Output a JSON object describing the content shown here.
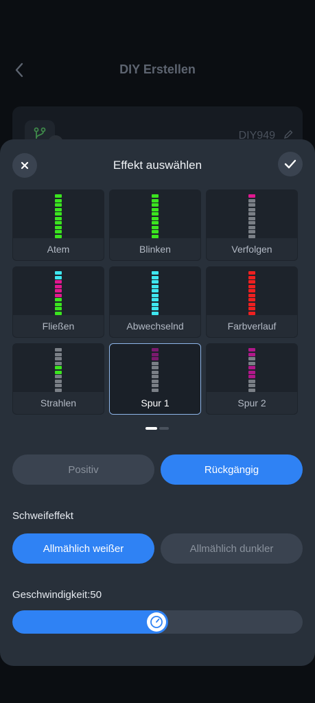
{
  "background": {
    "title": "DIY Erstellen",
    "device_name": "DIY949",
    "icons": {
      "back": "chevron-left-icon",
      "edit": "pencil-icon",
      "device": "branch-icon"
    }
  },
  "sheet": {
    "title": "Effekt auswählen",
    "icons": {
      "close": "close-icon",
      "confirm": "check-icon"
    }
  },
  "effects": [
    {
      "label": "Atem",
      "selected": false,
      "leds": [
        "#3be41f",
        "#3be41f",
        "#3be41f",
        "#3be41f",
        "#3be41f",
        "#3be41f",
        "#3be41f",
        "#3be41f",
        "#3be41f",
        "#3be41f"
      ]
    },
    {
      "label": "Blinken",
      "selected": false,
      "leds": [
        "#3be41f",
        "#3be41f",
        "#3be41f",
        "#3be41f",
        "#3be41f",
        "#3be41f",
        "#3be41f",
        "#3be41f",
        "#3be41f",
        "#3be41f"
      ]
    },
    {
      "label": "Verfolgen",
      "selected": false,
      "leds": [
        "#e0188f",
        "#7a7f86",
        "#7a7f86",
        "#7a7f86",
        "#7a7f86",
        "#7a7f86",
        "#7a7f86",
        "#7a7f86",
        "#7a7f86",
        "#7a7f86"
      ]
    },
    {
      "label": "Fließen",
      "selected": false,
      "leds": [
        "#3ee6ef",
        "#3ee6ef",
        "#e0188f",
        "#e0188f",
        "#e0188f",
        "#e0188f",
        "#3be41f",
        "#3be41f",
        "#3be41f",
        "#3be41f"
      ]
    },
    {
      "label": "Abwechselnd",
      "selected": false,
      "leds": [
        "#3ee6ef",
        "#3ee6ef",
        "#3ee6ef",
        "#3ee6ef",
        "#3ee6ef",
        "#3ee6ef",
        "#3ee6ef",
        "#3ee6ef",
        "#3ee6ef",
        "#3ee6ef"
      ]
    },
    {
      "label": "Farbverlauf",
      "selected": false,
      "leds": [
        "#ee2020",
        "#ee2020",
        "#ee2020",
        "#ee2020",
        "#ee2020",
        "#ee2020",
        "#ee2020",
        "#ee2020",
        "#ee2020",
        "#ee2020"
      ]
    },
    {
      "label": "Strahlen",
      "selected": false,
      "leds": [
        "#7a7f86",
        "#7a7f86",
        "#7a7f86",
        "#7a7f86",
        "#3be41f",
        "#3be41f",
        "#7a7f86",
        "#7a7f86",
        "#7a7f86",
        "#7a7f86"
      ]
    },
    {
      "label": "Spur 1",
      "selected": true,
      "leds": [
        "#7a1a6e",
        "#7a1a6e",
        "#7a1a6e",
        "#7a7f86",
        "#7a7f86",
        "#7a7f86",
        "#7a7f86",
        "#7a7f86",
        "#7a7f86",
        "#7a7f86"
      ]
    },
    {
      "label": "Spur 2",
      "selected": false,
      "leds": [
        "#b0188a",
        "#b0188a",
        "#7a7f86",
        "#7a7f86",
        "#b0188a",
        "#b0188a",
        "#b0188a",
        "#7a7f86",
        "#7a7f86",
        "#7a7f86"
      ]
    }
  ],
  "pager": {
    "pages": 2,
    "current": 1
  },
  "direction": {
    "options": [
      {
        "label": "Positiv",
        "active": false
      },
      {
        "label": "Rückgängig",
        "active": true
      }
    ]
  },
  "trail": {
    "label": "Schweifeffekt",
    "options": [
      {
        "label": "Allmählich weißer",
        "active": true
      },
      {
        "label": "Allmählich dunkler",
        "active": false
      }
    ]
  },
  "speed": {
    "label": "Geschwindigkeit:50",
    "value": 50,
    "max": 100
  },
  "colors": {
    "accent": "#2f82f4",
    "sheet_bg": "#28303a",
    "inactive": "#3a4350"
  }
}
